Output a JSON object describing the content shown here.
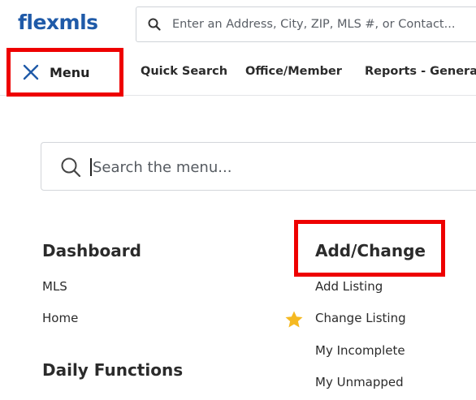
{
  "app": {
    "logo_text": "flexmls"
  },
  "header": {
    "search_placeholder": "Enter an Address, City, ZIP, MLS #, or Contact..."
  },
  "nav": {
    "menu_label": "Menu",
    "links": [
      "Quick Search",
      "Office/Member",
      "Reports - General"
    ]
  },
  "menu_panel": {
    "search_placeholder": "Search the menu...",
    "columns": [
      {
        "title": "Dashboard",
        "items": [
          "MLS",
          "Home"
        ],
        "next_title": "Daily Functions"
      },
      {
        "title": "Add/Change",
        "items": [
          "Add Listing",
          "Change Listing",
          "My Incomplete",
          "My Unmapped"
        ],
        "starred_item": "Change Listing"
      }
    ]
  },
  "colors": {
    "brand_blue": "#1f5aa8",
    "highlight_red": "#ee0000",
    "star_gold": "#f5b921"
  },
  "icons": {
    "search": "search-icon",
    "close": "close-icon",
    "favorite": "star-icon"
  }
}
